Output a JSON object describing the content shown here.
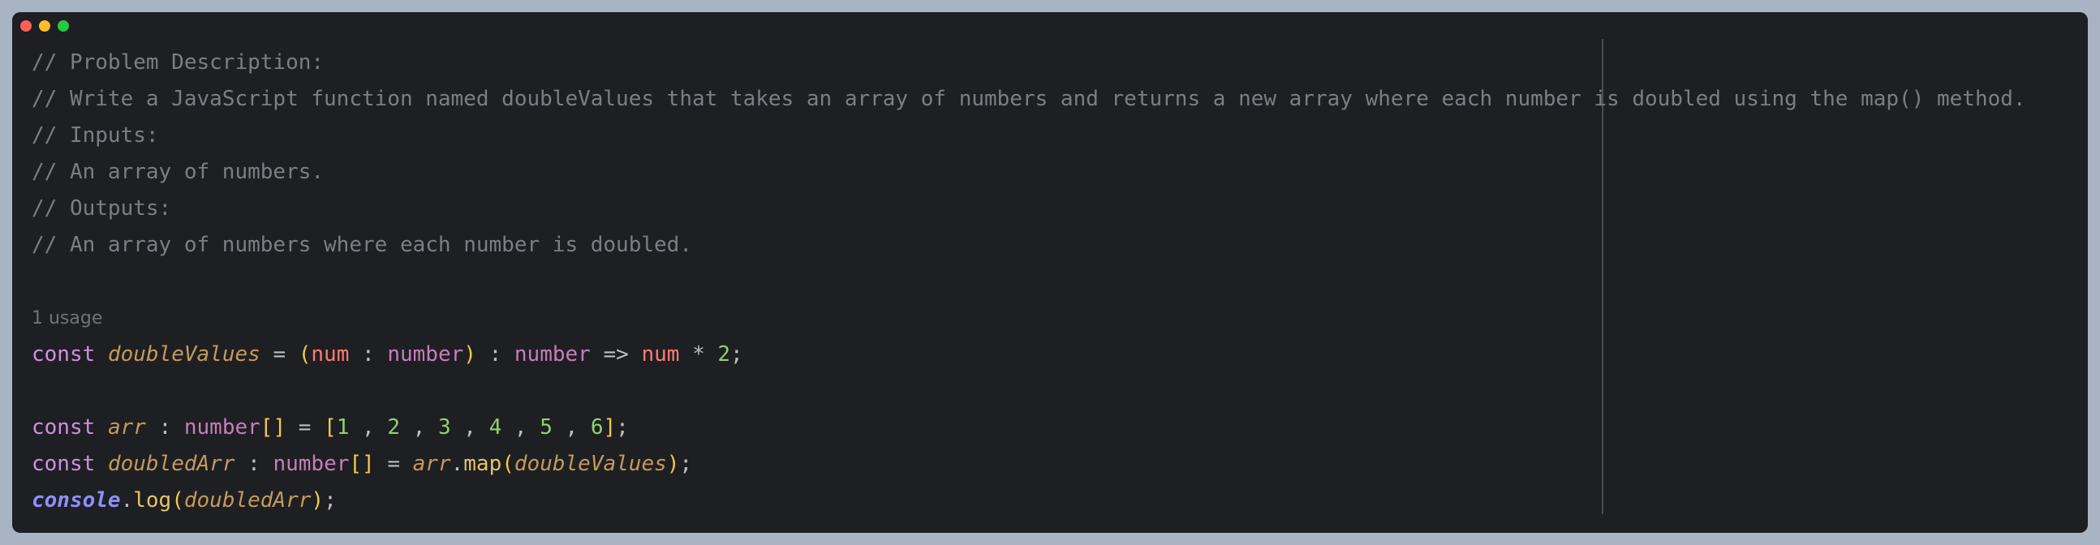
{
  "editor": {
    "comments": [
      "// Problem Description:",
      "// Write a JavaScript function named doubleValues that takes an array of numbers and returns a new array where each number is doubled using the map() method.",
      "// Inputs:",
      "// An array of numbers.",
      "// Outputs:",
      "// An array of numbers where each number is doubled."
    ],
    "usage_hint": "1 usage",
    "code": {
      "line1": {
        "kw": "const",
        "name": "doubleValues",
        "eq": "=",
        "open": "(",
        "param": "num",
        "colon": ":",
        "ptype": "number",
        "close": ")",
        "rtype": "number",
        "arrow": "=>",
        "body_var": "num",
        "times": "*",
        "literal": "2",
        "end": ";"
      },
      "line2": {
        "kw": "const",
        "name": "arr",
        "colon": ":",
        "type": "number",
        "brackets": "[]",
        "eq": "=",
        "open": "[",
        "values": [
          "1",
          "2",
          "3",
          "4",
          "5",
          "6"
        ],
        "sep": ",",
        "close": "]",
        "end": ";"
      },
      "line3": {
        "kw": "const",
        "name": "doubledArr",
        "colon": ":",
        "type": "number",
        "brackets": "[]",
        "eq": "=",
        "obj": "arr",
        "dot": ".",
        "method": "map",
        "open": "(",
        "arg": "doubleValues",
        "close": ")",
        "end": ";"
      },
      "line4": {
        "obj": "console",
        "dot": ".",
        "method": "log",
        "open": "(",
        "arg": "doubledArr",
        "close": ")",
        "end": ";"
      }
    }
  },
  "colors": {
    "background": "#1e1f22",
    "comment": "#7a7e85",
    "keyword": "#cf8ee5",
    "function_name": "#c49a5a",
    "number": "#8fd26f"
  }
}
